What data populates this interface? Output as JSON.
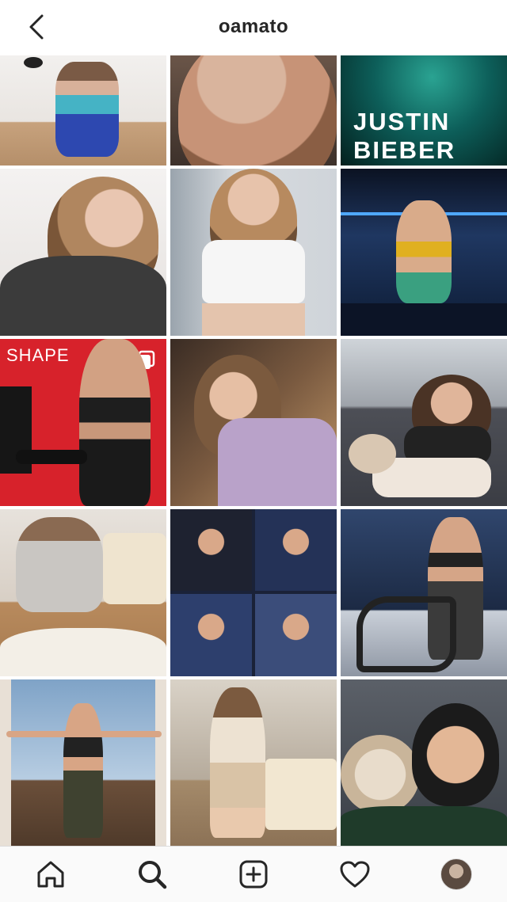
{
  "header": {
    "username": "oamato",
    "back_icon": "chevron-left-icon"
  },
  "grid": {
    "tiles": [
      {
        "name": "post-1",
        "desc_colors": [
          "#e7e3df",
          "#2b44a8",
          "#3fb3c2"
        ]
      },
      {
        "name": "post-2",
        "desc_colors": [
          "#c7977d",
          "#2e2420"
        ]
      },
      {
        "name": "post-3",
        "overlay_lines": [
          "JUSTIN",
          "BIEBER"
        ],
        "desc_colors": [
          "#0d5f5a",
          "#04201e"
        ]
      },
      {
        "name": "post-4",
        "desc_colors": [
          "#f1efee",
          "#3a3a3a"
        ]
      },
      {
        "name": "post-5",
        "desc_colors": [
          "#c8ccd1",
          "#f4f4f4"
        ]
      },
      {
        "name": "post-6",
        "desc_colors": [
          "#1d2a4a",
          "#0a1120"
        ]
      },
      {
        "name": "post-7",
        "overlay_lines": [
          "SHAPE"
        ],
        "multi": true,
        "desc_colors": [
          "#d7222b",
          "#1a1a1a"
        ]
      },
      {
        "name": "post-8",
        "desc_colors": [
          "#b9a2c9",
          "#3b2c25"
        ]
      },
      {
        "name": "post-9",
        "desc_colors": [
          "#8d8f97",
          "#e7dfd8"
        ]
      },
      {
        "name": "post-10",
        "desc_colors": [
          "#d8cfc5",
          "#f3efe7"
        ]
      },
      {
        "name": "post-11",
        "desc_colors": [
          "#1a2238",
          "#3b4d7a"
        ]
      },
      {
        "name": "post-12",
        "desc_colors": [
          "#30466d",
          "#1a1f28"
        ]
      },
      {
        "name": "post-13",
        "desc_colors": [
          "#7fa3c7",
          "#2a2a2a"
        ]
      },
      {
        "name": "post-14",
        "desc_colors": [
          "#d9d2c7",
          "#a48a6a"
        ]
      },
      {
        "name": "post-15",
        "desc_colors": [
          "#5b6068",
          "#d2c3ae"
        ]
      }
    ]
  },
  "tabbar": {
    "items": [
      {
        "name": "home",
        "icon": "home-icon"
      },
      {
        "name": "search",
        "icon": "search-icon"
      },
      {
        "name": "new-post",
        "icon": "plus-square-icon"
      },
      {
        "name": "activity",
        "icon": "heart-icon"
      },
      {
        "name": "profile",
        "icon": "avatar-icon"
      }
    ]
  }
}
